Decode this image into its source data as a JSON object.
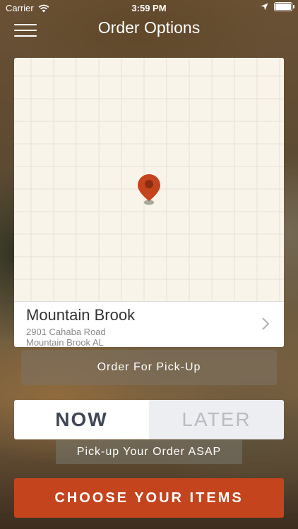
{
  "status_bar": {
    "carrier": "Carrier",
    "time": "3:59 PM",
    "battery_level": 1.0,
    "icons": [
      "wifi-icon",
      "location-arrow-icon",
      "battery-icon"
    ]
  },
  "nav": {
    "title": "Order Options",
    "menu_icon": "hamburger-menu-icon"
  },
  "location": {
    "name": "Mountain Brook",
    "address_line1": "2901 Cahaba Road",
    "address_line2": "Mountain Brook AL",
    "chevron_icon": "chevron-right-icon",
    "pin_icon": "map-pin-icon"
  },
  "order_type_label": "Order For Pick-Up",
  "timing": {
    "options": [
      "NOW",
      "LATER"
    ],
    "selected": "NOW",
    "note": "Pick-up Your Order ASAP"
  },
  "cta_label": "CHOOSE YOUR ITEMS",
  "colors": {
    "accent": "#c4441e",
    "pin": "#c4441e",
    "map_background": "#f8f4ea",
    "segment_selected_text": "#404856",
    "segment_unselected_text": "#b9bcc2"
  }
}
